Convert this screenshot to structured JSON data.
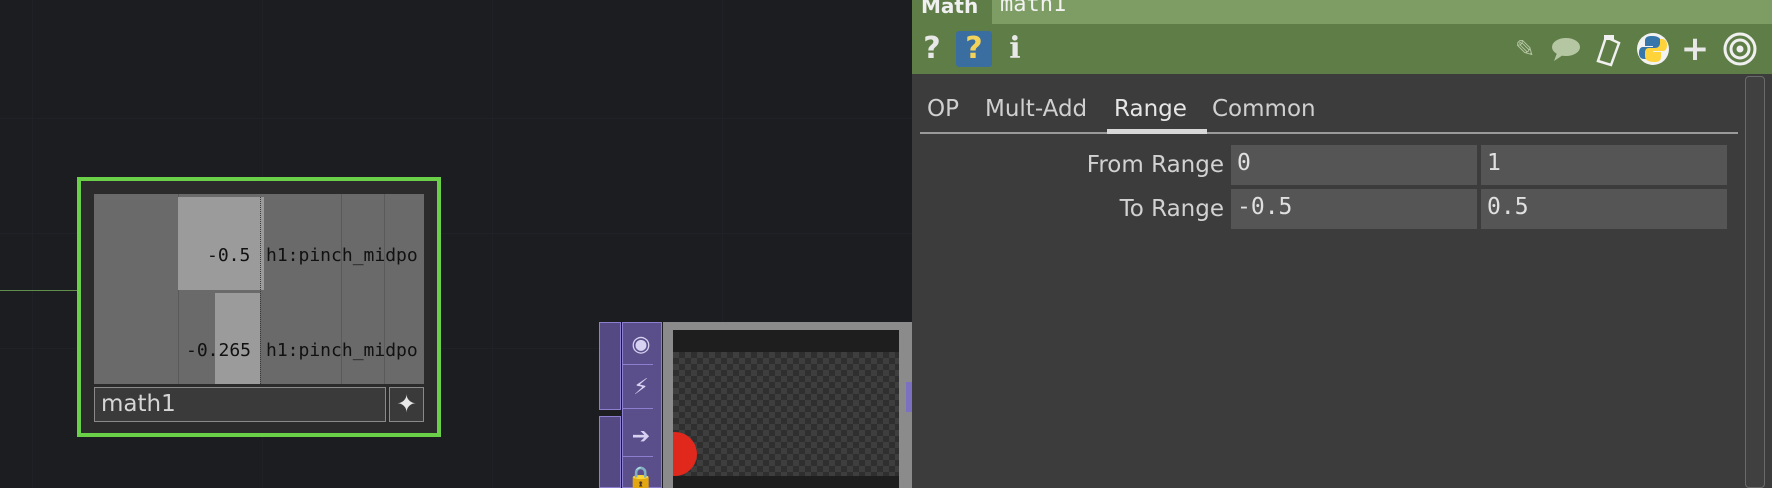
{
  "network": {
    "math_node": {
      "name": "math1",
      "channels": [
        {
          "value": "-0.5",
          "label": "h1:pinch_midpo",
          "level": 1.0
        },
        {
          "value": "-0.265",
          "label": "h1:pinch_midpo",
          "level": 0.53
        }
      ]
    },
    "flag_icon": "sparkle-icon",
    "node2_icons": [
      "viewer-icon",
      "bypass-icon",
      "arrow-icon",
      "lock-icon"
    ]
  },
  "panel": {
    "op_type": "Math",
    "op_name": "math1",
    "icons": [
      "help-icon",
      "python-help-icon",
      "info-icon",
      "edit-icon",
      "comment-icon",
      "clipboard-icon",
      "python-icon",
      "add-icon",
      "target-icon"
    ],
    "tabs": [
      {
        "label": "OP"
      },
      {
        "label": "Mult-Add"
      },
      {
        "label": "Range"
      },
      {
        "label": "Common"
      }
    ],
    "active_tab": "Range",
    "params": [
      {
        "label": "From Range",
        "values": [
          "0",
          "1"
        ]
      },
      {
        "label": "To Range",
        "values": [
          "-0.5",
          "0.5"
        ]
      }
    ]
  },
  "colors": {
    "header_green": "#5f7d46",
    "selected_node_border": "#69d048",
    "node2_purple": "#5a4f8a",
    "red_dot": "#e0281d"
  }
}
